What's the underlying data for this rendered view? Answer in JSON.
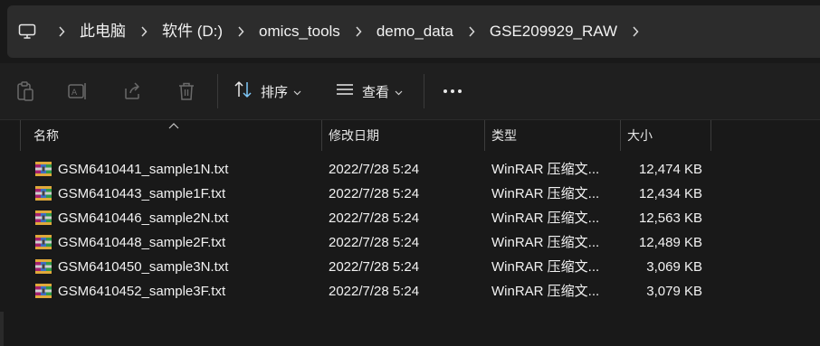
{
  "address": {
    "pc_icon": "monitor-icon",
    "crumbs": [
      "此电脑",
      "软件 (D:)",
      "omics_tools",
      "demo_data",
      "GSE209929_RAW"
    ]
  },
  "toolbar": {
    "sort_label": "排序",
    "view_label": "查看",
    "icons": [
      "paste-icon",
      "rename-icon",
      "share-icon",
      "delete-icon",
      "sort-icon",
      "view-icon",
      "more-icon"
    ]
  },
  "columns": {
    "name": "名称",
    "modified": "修改日期",
    "type": "类型",
    "size": "大小"
  },
  "files": [
    {
      "name": "GSM6410441_sample1N.txt",
      "modified": "2022/7/28 5:24",
      "type": "WinRAR 压缩文...",
      "size": "12,474 KB"
    },
    {
      "name": "GSM6410443_sample1F.txt",
      "modified": "2022/7/28 5:24",
      "type": "WinRAR 压缩文...",
      "size": "12,434 KB"
    },
    {
      "name": "GSM6410446_sample2N.txt",
      "modified": "2022/7/28 5:24",
      "type": "WinRAR 压缩文...",
      "size": "12,563 KB"
    },
    {
      "name": "GSM6410448_sample2F.txt",
      "modified": "2022/7/28 5:24",
      "type": "WinRAR 压缩文...",
      "size": "12,489 KB"
    },
    {
      "name": "GSM6410450_sample3N.txt",
      "modified": "2022/7/28 5:24",
      "type": "WinRAR 压缩文...",
      "size": "3,069 KB"
    },
    {
      "name": "GSM6410452_sample3F.txt",
      "modified": "2022/7/28 5:24",
      "type": "WinRAR 压缩文...",
      "size": "3,079 KB"
    }
  ],
  "colors": {
    "background": "#191919",
    "address_bar": "#2c2c2c",
    "text": "#f2f2f2",
    "accent": "#60cdff"
  }
}
